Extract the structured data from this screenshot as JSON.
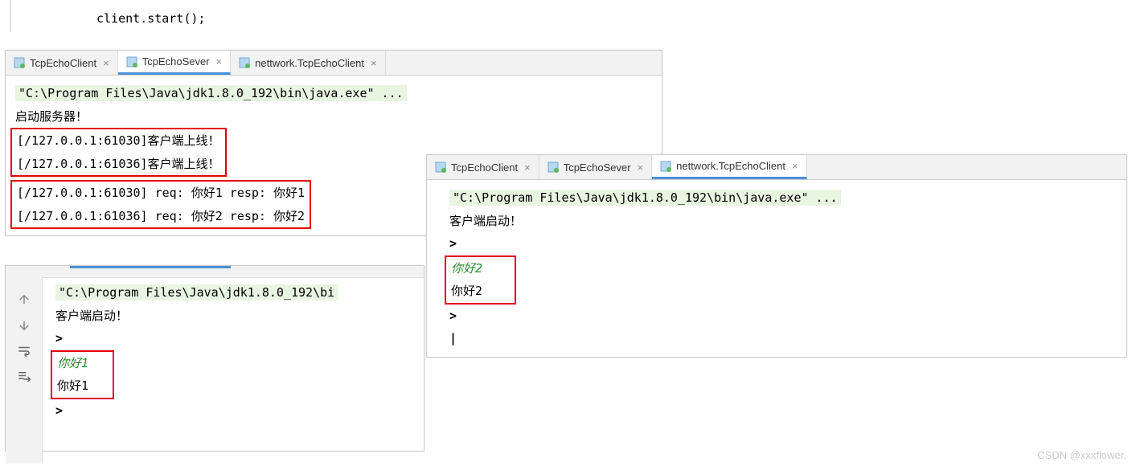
{
  "editor": {
    "code_line": "client.start();"
  },
  "server_panel": {
    "tabs": [
      {
        "label": "TcpEchoClient",
        "active": false
      },
      {
        "label": "TcpEchoSever",
        "active": true
      },
      {
        "label": "nettwork.TcpEchoClient",
        "active": false
      }
    ],
    "cmd": "\"C:\\Program Files\\Java\\jdk1.8.0_192\\bin\\java.exe\" ...",
    "start_msg": "启动服务器！",
    "box1_line1": "[/127.0.0.1:61030]客户端上线！",
    "box1_line2": "[/127.0.0.1:61036]客户端上线！",
    "box2_line1": "[/127.0.0.1:61030] req: 你好1 resp: 你好1",
    "box2_line2": "[/127.0.0.1:61036] req: 你好2 resp: 你好2"
  },
  "client1_panel": {
    "cmd": "\"C:\\Program Files\\Java\\jdk1.8.0_192\\bi",
    "start_msg": "客户端启动！",
    "prompt1": ">",
    "input": "你好1",
    "response": "你好1",
    "prompt2": ">"
  },
  "client2_panel": {
    "tabs": [
      {
        "label": "TcpEchoClient",
        "active": false
      },
      {
        "label": "TcpEchoSever",
        "active": false
      },
      {
        "label": "nettwork.TcpEchoClient",
        "active": true
      }
    ],
    "cmd": "\"C:\\Program Files\\Java\\jdk1.8.0_192\\bin\\java.exe\" ...",
    "start_msg": "客户端启动！",
    "prompt1": ">",
    "input": "你好2",
    "response": "你好2",
    "prompt2": ">",
    "cursor": "|"
  },
  "watermark": "CSDN @xxxflower."
}
